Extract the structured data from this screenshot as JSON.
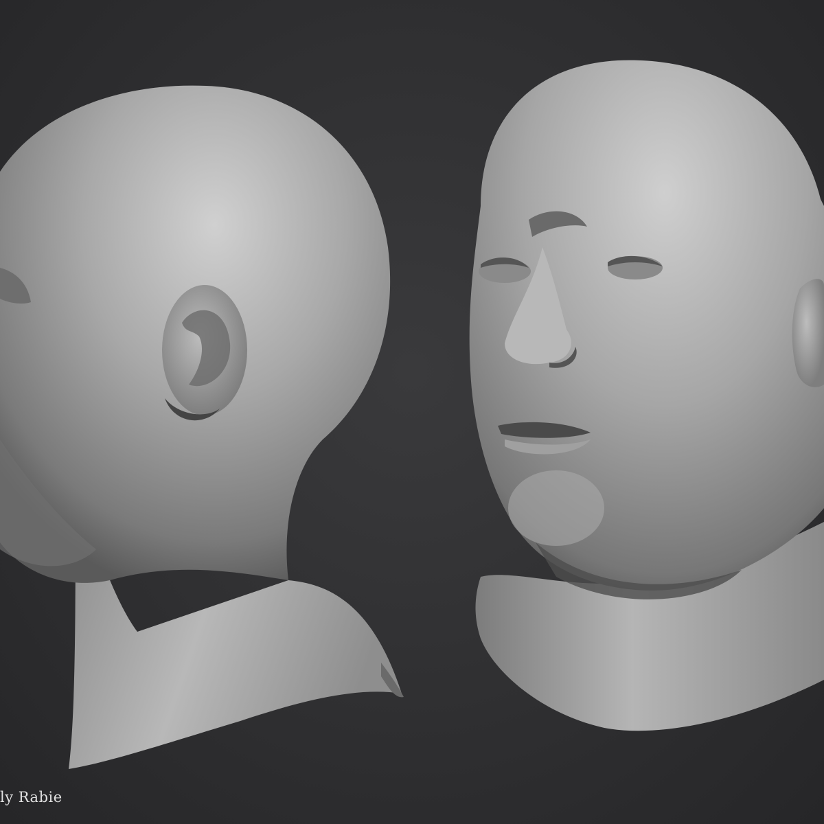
{
  "credit": {
    "text": "ly Rabie"
  },
  "colors": {
    "background": "#2f2f31",
    "clay": "#9b9b9b",
    "clay_highlight": "#d4d4d4",
    "clay_shadow": "#4a4a4a"
  }
}
